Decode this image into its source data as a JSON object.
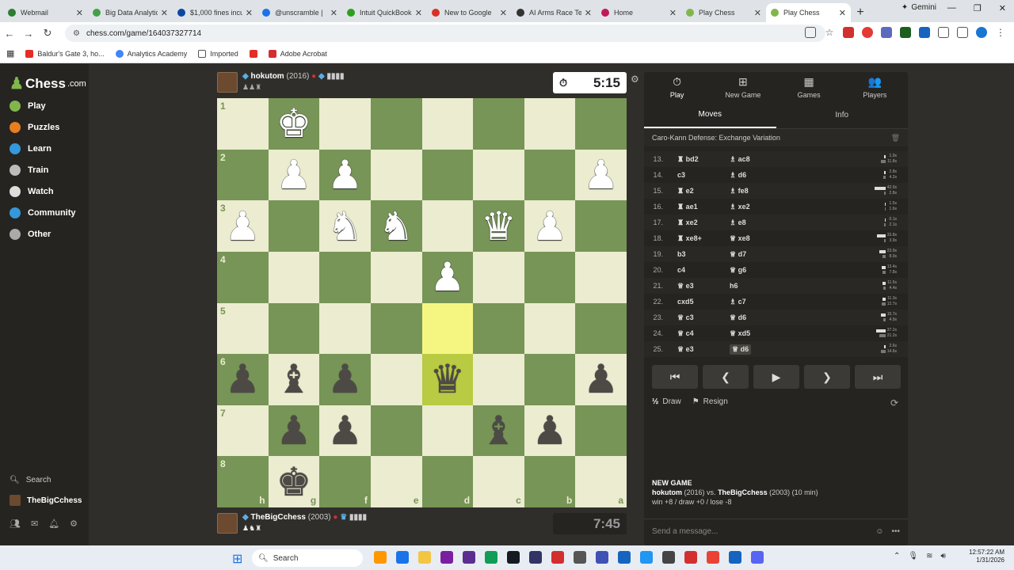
{
  "browser": {
    "tabs": [
      {
        "title": "Webmail",
        "color": "#2e7d32"
      },
      {
        "title": "Big Data Analytic",
        "color": "#43a047"
      },
      {
        "title": "$1,000 fines incu",
        "color": "#0d47a1"
      },
      {
        "title": "@unscramble | ",
        "color": "#1a73e8"
      },
      {
        "title": "Intuit QuickBook",
        "color": "#2ca01c"
      },
      {
        "title": "New to Google",
        "color": "#d93025"
      },
      {
        "title": "AI Arms Race Te",
        "color": "#333333"
      },
      {
        "title": "Home",
        "color": "#c2185b"
      },
      {
        "title": "Play Chess",
        "color": "#81b64c"
      },
      {
        "title": "Play Chess",
        "color": "#81b64c"
      }
    ],
    "new_tab": "+",
    "gemini": "Gemini",
    "url": "chess.com/game/164037327714",
    "bookmarks": [
      "Baldur's Gate 3, ho...",
      "Analytics Academy",
      "Imported",
      "Adobe Acrobat"
    ]
  },
  "sidebar": {
    "logo": "Chess",
    "logo_suffix": ".com",
    "items": [
      {
        "label": "Play",
        "color": "#81b64c"
      },
      {
        "label": "Puzzles",
        "color": "#e67e22"
      },
      {
        "label": "Learn",
        "color": "#3498db"
      },
      {
        "label": "Train",
        "color": "#bbbbbb"
      },
      {
        "label": "Watch",
        "color": "#dddddd"
      },
      {
        "label": "Community",
        "color": "#3498db"
      },
      {
        "label": "Other",
        "color": "#aaaaaa"
      }
    ],
    "search": "Search",
    "user": "TheBigCchess"
  },
  "top_player": {
    "name": "hokutom",
    "rating": "(2016)",
    "clock": "5:15"
  },
  "bottom_player": {
    "name": "TheBigCchess",
    "rating": "(2003)",
    "clock": "7:45"
  },
  "board": {
    "ranks": [
      "1",
      "2",
      "3",
      "4",
      "5",
      "6",
      "7",
      "8"
    ],
    "files": [
      "h",
      "g",
      "f",
      "e",
      "d",
      "c",
      "b",
      "a"
    ],
    "pieces": [
      {
        "r": 0,
        "c": 1,
        "p": "♚",
        "side": "w"
      },
      {
        "r": 1,
        "c": 1,
        "p": "♟",
        "side": "w"
      },
      {
        "r": 1,
        "c": 2,
        "p": "♟",
        "side": "w"
      },
      {
        "r": 1,
        "c": 7,
        "p": "♟",
        "side": "w"
      },
      {
        "r": 2,
        "c": 0,
        "p": "♟",
        "side": "w"
      },
      {
        "r": 2,
        "c": 2,
        "p": "♞",
        "side": "w"
      },
      {
        "r": 2,
        "c": 3,
        "p": "♞",
        "side": "w"
      },
      {
        "r": 2,
        "c": 5,
        "p": "♛",
        "side": "w"
      },
      {
        "r": 2,
        "c": 6,
        "p": "♟",
        "side": "w"
      },
      {
        "r": 3,
        "c": 4,
        "p": "♟",
        "side": "w"
      },
      {
        "r": 5,
        "c": 0,
        "p": "♟",
        "side": "b"
      },
      {
        "r": 5,
        "c": 1,
        "p": "♝",
        "side": "b"
      },
      {
        "r": 5,
        "c": 2,
        "p": "♟",
        "side": "b"
      },
      {
        "r": 5,
        "c": 4,
        "p": "♛",
        "side": "b"
      },
      {
        "r": 5,
        "c": 7,
        "p": "♟",
        "side": "b"
      },
      {
        "r": 6,
        "c": 1,
        "p": "♟",
        "side": "b"
      },
      {
        "r": 6,
        "c": 2,
        "p": "♟",
        "side": "b"
      },
      {
        "r": 6,
        "c": 5,
        "p": "♝",
        "side": "b"
      },
      {
        "r": 6,
        "c": 6,
        "p": "♟",
        "side": "b"
      },
      {
        "r": 7,
        "c": 1,
        "p": "♚",
        "side": "b"
      }
    ],
    "highlight": [
      {
        "r": 4,
        "c": 4
      },
      {
        "r": 5,
        "c": 4
      }
    ]
  },
  "panel": {
    "tabs": [
      {
        "label": "Play",
        "icon": "⏱"
      },
      {
        "label": "New Game",
        "icon": "⊞"
      },
      {
        "label": "Games",
        "icon": "▦"
      },
      {
        "label": "Players",
        "icon": "👥"
      }
    ],
    "subtabs": [
      "Moves",
      "Info"
    ],
    "opening": "Caro-Kann Defense: Exchange Variation",
    "moves": [
      {
        "n": "13.",
        "w": "♜ bd2",
        "b": "♗ ac8",
        "t1": "1.9s",
        "t2": "11.8s",
        "ww": 2,
        "bw": 6
      },
      {
        "n": "14.",
        "w": "c3",
        "b": "♗ d6",
        "t1": "2.8s",
        "t2": "4.2s",
        "ww": 2,
        "bw": 3
      },
      {
        "n": "15.",
        "w": "♜ e2",
        "b": "♗ fe8",
        "t1": "42.0s",
        "t2": "2.8s",
        "ww": 14,
        "bw": 2
      },
      {
        "n": "16.",
        "w": "♜ ae1",
        "b": "♗ xe2",
        "t1": "1.5s",
        "t2": "1.6s",
        "ww": 1,
        "bw": 1
      },
      {
        "n": "17.",
        "w": "♜ xe2",
        "b": "♗ e8",
        "t1": "0.1s",
        "t2": "2.1s",
        "ww": 1,
        "bw": 2
      },
      {
        "n": "18.",
        "w": "♜ xe8+",
        "b": "♕ xe8",
        "t1": "33.8s",
        "t2": "3.9s",
        "ww": 11,
        "bw": 2
      },
      {
        "n": "19.",
        "w": "b3",
        "b": "♕ d7",
        "t1": "23.9s",
        "t2": "8.0s",
        "ww": 8,
        "bw": 4
      },
      {
        "n": "20.",
        "w": "c4",
        "b": "♕ g6",
        "t1": "13.4s",
        "t2": "7.8s",
        "ww": 5,
        "bw": 4
      },
      {
        "n": "21.",
        "w": "♕ e3",
        "b": "h6",
        "t1": "11.5s",
        "t2": "4.4s",
        "ww": 4,
        "bw": 3
      },
      {
        "n": "22.",
        "w": "cxd5",
        "b": "♗ c7",
        "t1": "11.3s",
        "t2": "12.7s",
        "ww": 4,
        "bw": 5
      },
      {
        "n": "23.",
        "w": "♕ c3",
        "b": "♕ d6",
        "t1": "15.7s",
        "t2": "4.9s",
        "ww": 6,
        "bw": 3
      },
      {
        "n": "24.",
        "w": "♕ c4",
        "b": "♕ xd5",
        "t1": "37.2s",
        "t2": "21.2s",
        "ww": 12,
        "bw": 8
      },
      {
        "n": "25.",
        "w": "♕ e3",
        "b": "♕ d6",
        "t1": "2.6s",
        "t2": "14.6s",
        "ww": 2,
        "bw": 6
      }
    ],
    "controls": [
      "⏮",
      "❮",
      "▶",
      "❯",
      "⏭"
    ],
    "draw": "Draw",
    "resign": "Resign",
    "new_game_title": "NEW GAME",
    "new_game_p1": "hokutom",
    "new_game_r1": "(2016) vs.",
    "new_game_p2": "TheBigCchess",
    "new_game_r2": "(2003) (10 min)",
    "new_game_stats": "win +8 / draw +0 / lose -8",
    "message_placeholder": "Send a message..."
  },
  "taskbar": {
    "search": "Search",
    "time": "12:57:22 AM",
    "date": "1/31/2026",
    "apps": [
      "#ff9800",
      "#1a73e8",
      "#f4c542",
      "#7b1fa2",
      "#5c2d91",
      "#0f9d58",
      "#171a21",
      "#333366",
      "#d32f2f",
      "#555555",
      "#3f51b5",
      "#1565c0",
      "#2196f3",
      "#444444",
      "#d32f2f",
      "#ea4335",
      "#1565c0",
      "#5865f2"
    ]
  }
}
